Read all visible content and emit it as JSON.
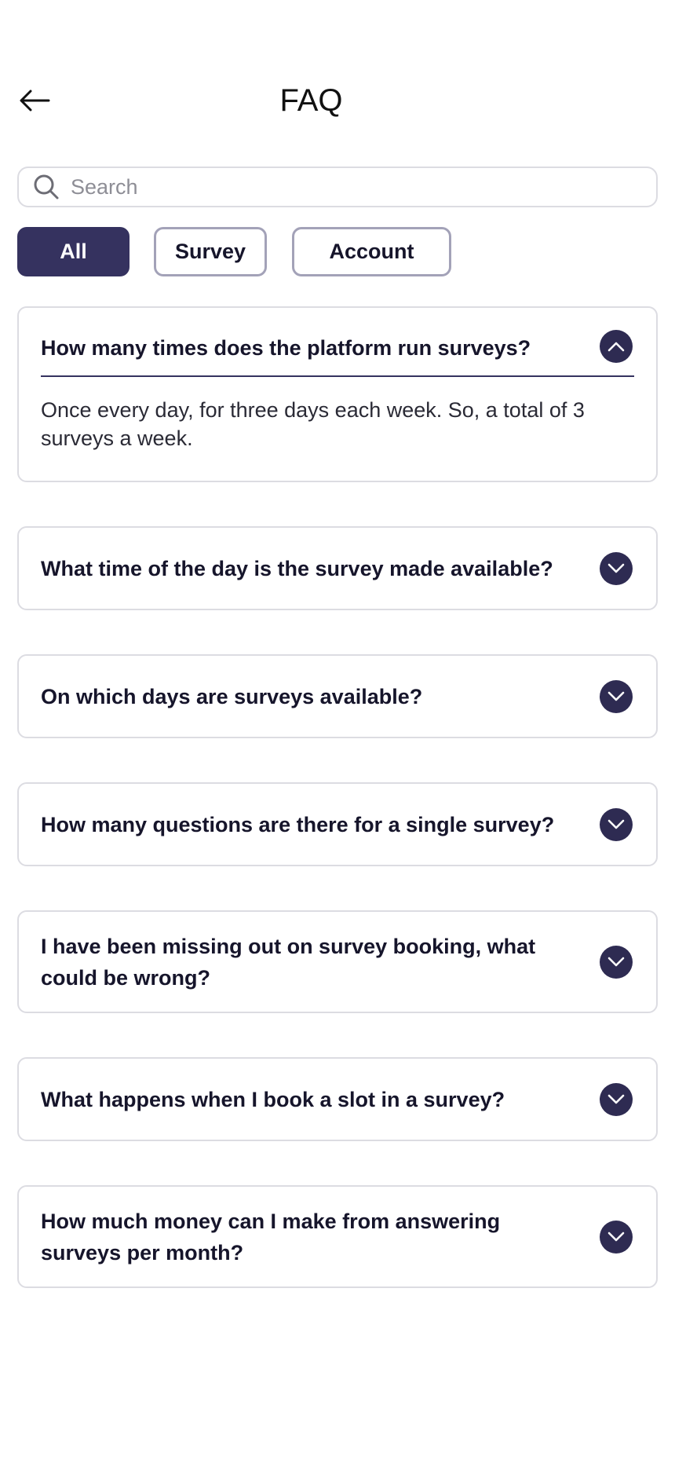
{
  "header": {
    "back_icon": "arrow-left-icon",
    "title": "FAQ"
  },
  "search": {
    "placeholder": "Search",
    "value": "",
    "icon": "search-icon"
  },
  "filters": {
    "selected": "All",
    "chips": [
      {
        "label": "All",
        "active": true
      },
      {
        "label": "Survey",
        "active": false
      },
      {
        "label": "Account",
        "active": false
      }
    ]
  },
  "colors": {
    "accent": "#35325f",
    "chip_border": "#a3a2b8",
    "card_border": "#dcdce2"
  },
  "faqs": [
    {
      "question": "How many times does the platform run surveys?",
      "answer": "Once every day, for three days each week. So, a total of 3 surveys a week.",
      "expanded": true,
      "toggle_icon": "chevron-up-icon"
    },
    {
      "question": "What time of the day is the survey made available?",
      "expanded": false,
      "toggle_icon": "chevron-down-icon"
    },
    {
      "question": "On which days are surveys available?",
      "expanded": false,
      "toggle_icon": "chevron-down-icon"
    },
    {
      "question": "How many questions are there for a single survey?",
      "expanded": false,
      "toggle_icon": "chevron-down-icon"
    },
    {
      "question": "I have been missing out on survey booking, what could be wrong?",
      "expanded": false,
      "toggle_icon": "chevron-down-icon"
    },
    {
      "question": "What happens when I book a slot in a survey?",
      "expanded": false,
      "toggle_icon": "chevron-down-icon"
    },
    {
      "question": "How much money can I make from answering surveys per month?",
      "expanded": false,
      "toggle_icon": "chevron-down-icon"
    }
  ]
}
